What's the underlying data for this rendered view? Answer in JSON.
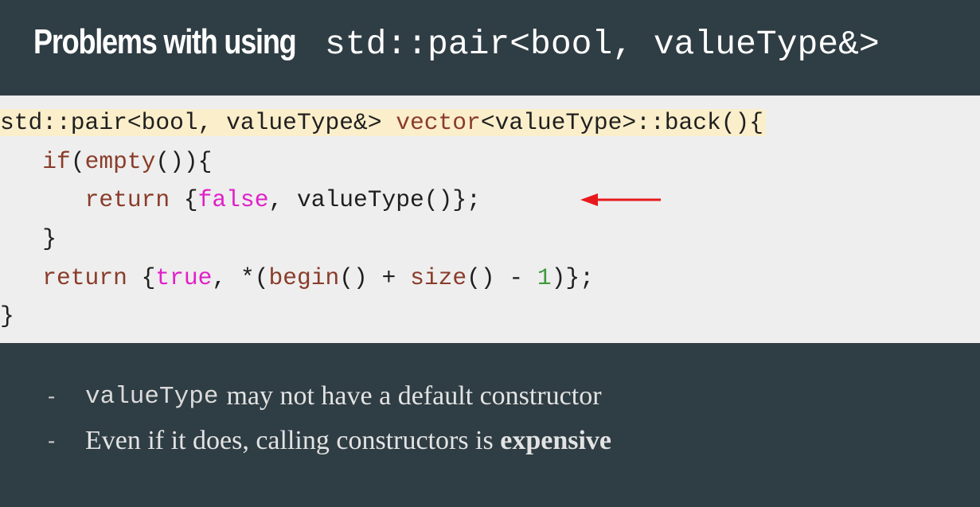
{
  "title": {
    "text": "Problems with using",
    "code": "std::pair<bool, valueType&>"
  },
  "code": {
    "line1": {
      "ret_type": "std::pair<bool, valueType&>",
      "space": " ",
      "class_name": "vector",
      "rest": "<valueType>::back(){"
    },
    "line2": {
      "indent": "   ",
      "kw_if": "if",
      "paren": "(",
      "call": "empty",
      "rest": "()){"
    },
    "line3": {
      "indent": "      ",
      "kw_return": "return",
      "open": " {",
      "lit_false": "false",
      "rest": ", valueType()};"
    },
    "line4": {
      "text": "   }"
    },
    "line5": {
      "indent": "   ",
      "kw_return": "return",
      "open": " {",
      "lit_true": "true",
      "mid": ", *(",
      "call_begin": "begin",
      "plus": "() + ",
      "call_size": "size",
      "minus": "() - ",
      "num": "1",
      "end": ")};"
    },
    "line6": {
      "text": "}"
    }
  },
  "arrow_color": "#e8191c",
  "bullets": {
    "dash": "-",
    "item1": {
      "code": "valueType",
      "text": "may not have a default constructor"
    },
    "item2": {
      "text": "Even if it does, calling constructors is",
      "bold": "expensive"
    }
  }
}
